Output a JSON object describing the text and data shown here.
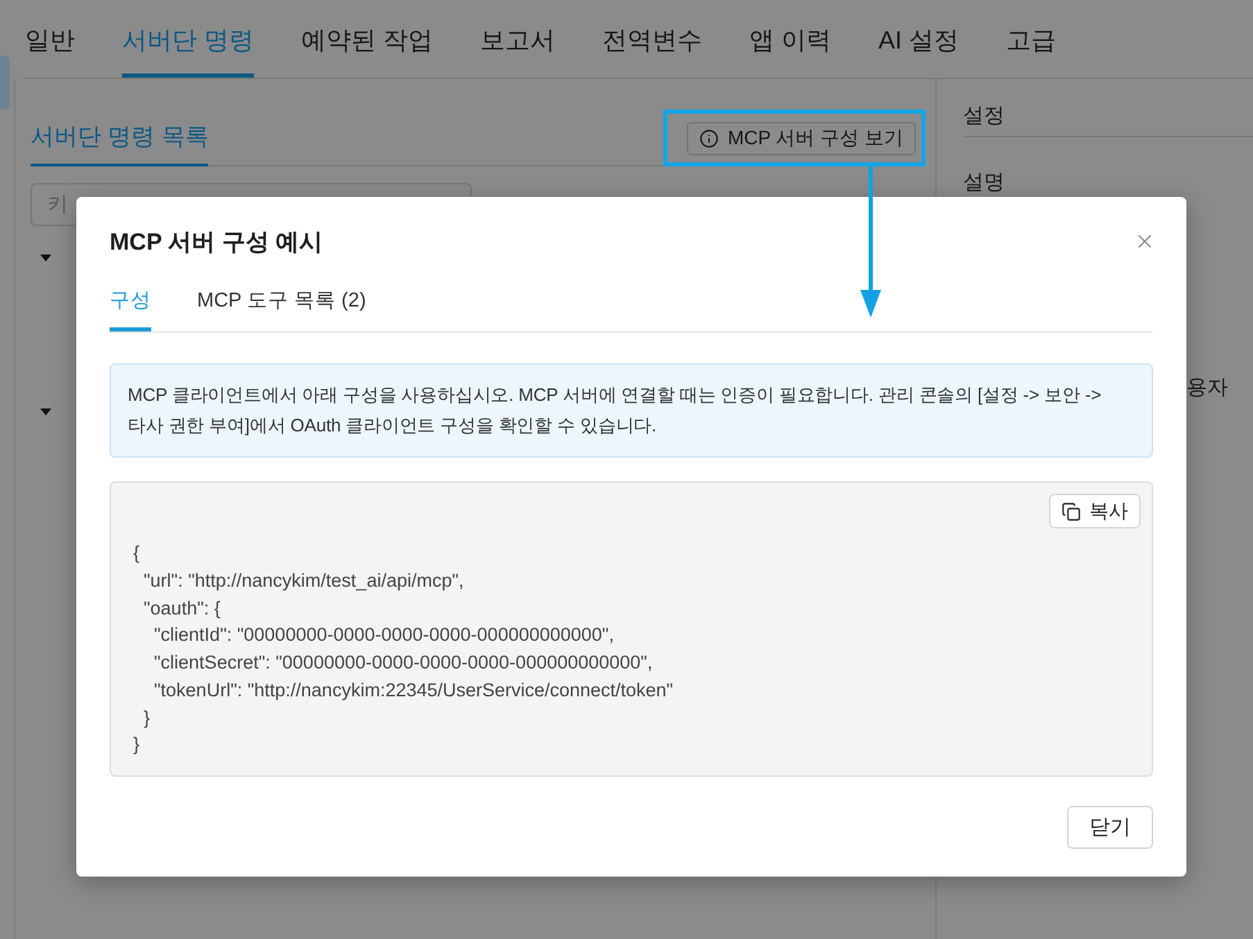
{
  "tabs": [
    {
      "label": "일반",
      "selected": false
    },
    {
      "label": "서버단 명령",
      "selected": true
    },
    {
      "label": "예약된 작업",
      "selected": false
    },
    {
      "label": "보고서",
      "selected": false
    },
    {
      "label": "전역변수",
      "selected": false
    },
    {
      "label": "앱 이력",
      "selected": false
    },
    {
      "label": "AI 설정",
      "selected": false
    },
    {
      "label": "고급",
      "selected": false
    }
  ],
  "left_panel": {
    "title": "서버단 명령 목록",
    "mcp_button": "MCP 서버 구성 보기",
    "search": {
      "placeholder": "키"
    },
    "tree": [
      {
        "expanded": true
      },
      {
        "expanded": true
      }
    ]
  },
  "right_panel": {
    "title": "설정",
    "labels": [
      "설명",
      "용자"
    ]
  },
  "modal": {
    "title": "MCP 서버 구성 예시",
    "tabs": [
      {
        "label": "구성",
        "selected": true
      },
      {
        "label": "MCP 도구 목록 (2)",
        "selected": false
      }
    ],
    "notice": "MCP 클라이언트에서 아래 구성을 사용하십시오. MCP 서버에 연결할 때는 인증이 필요합니다. 관리 콘솔의 [설정 -> 보안 -> 타사 권한 부여]에서 OAuth 클라이언트 구성을 확인할 수 있습니다.",
    "copy_button": "복사",
    "code_lines": [
      "{",
      "  \"url\": \"http://nancykim/test_ai/api/mcp\",",
      "  \"oauth\": {",
      "    \"clientId\": \"00000000-0000-0000-0000-000000000000\",",
      "    \"clientSecret\": \"00000000-0000-0000-0000-000000000000\",",
      "    \"tokenUrl\": \"http://nancykim:22345/UserService/connect/token\"",
      "  }",
      "}"
    ],
    "close_button": "닫기"
  }
}
